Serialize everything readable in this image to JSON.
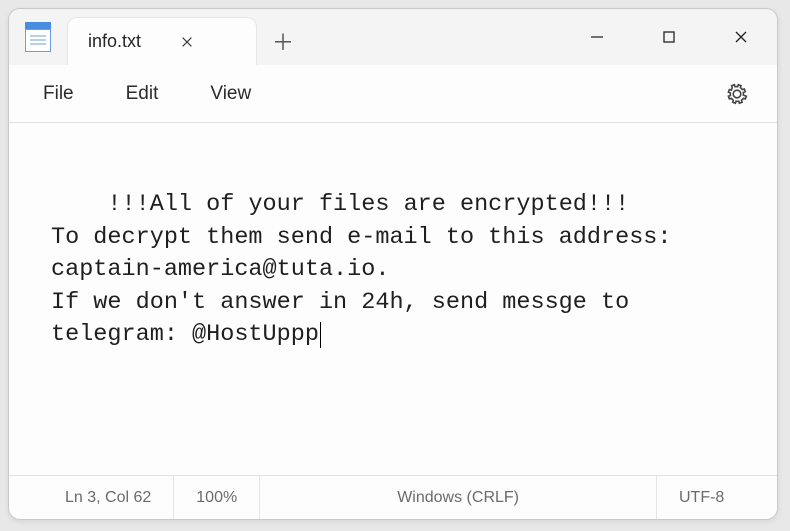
{
  "tab": {
    "title": "info.txt"
  },
  "menu": {
    "file": "File",
    "edit": "Edit",
    "view": "View"
  },
  "editor": {
    "content": "!!!All of your files are encrypted!!!\nTo decrypt them send e-mail to this address: captain-america@tuta.io.\nIf we don't answer in 24h, send messge to telegram: @HostUppp"
  },
  "status": {
    "position": "Ln 3, Col 62",
    "zoom": "100%",
    "line_ending": "Windows (CRLF)",
    "encoding": "UTF-8"
  }
}
